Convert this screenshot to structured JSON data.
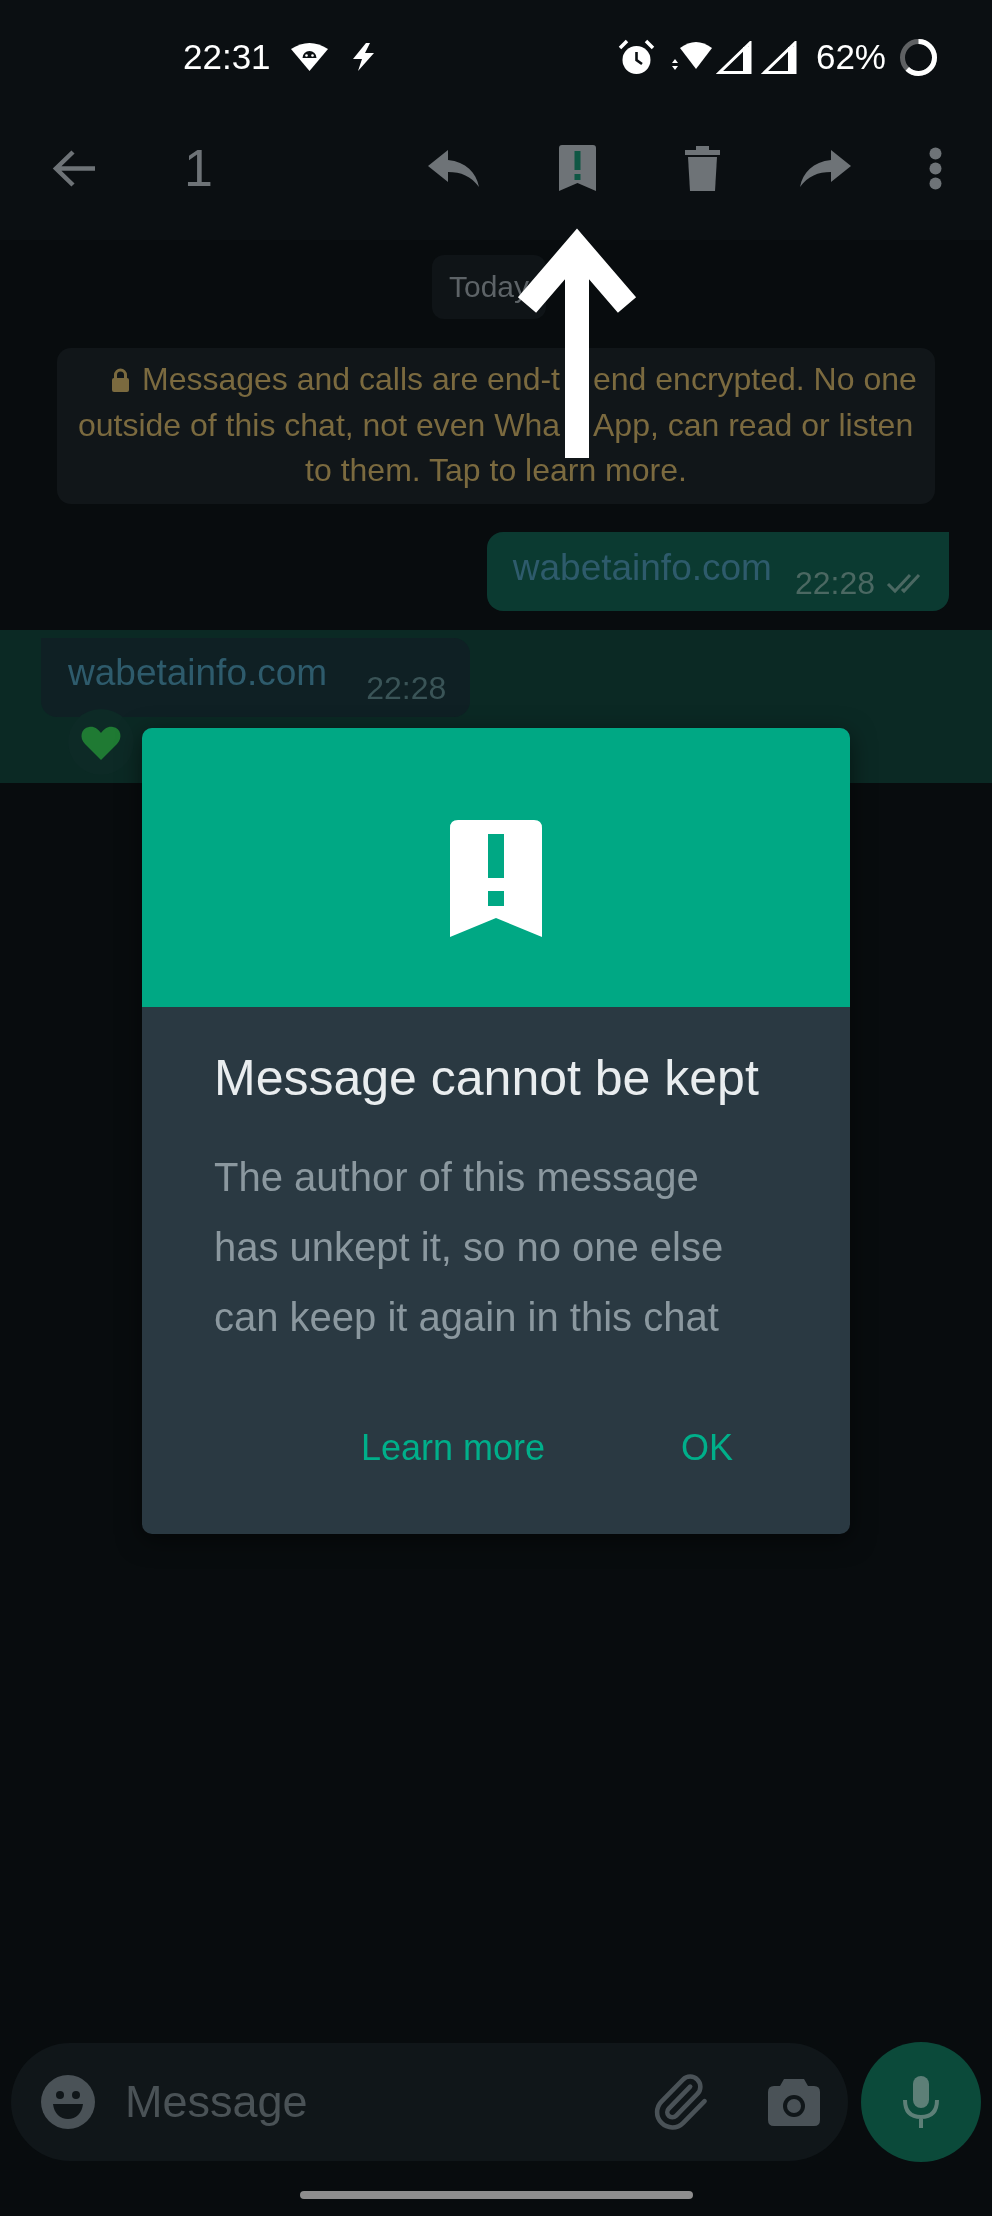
{
  "status_bar": {
    "time": "22:31",
    "battery": "62%"
  },
  "toolbar": {
    "selected_count": "1"
  },
  "chat": {
    "date": "Today",
    "encryption_notice": {
      "lines": [
        [
          "Messages and calls are end-t",
          "end encrypted. No one"
        ],
        [
          "outside of this chat, not even Wha",
          "App, can read or listen"
        ],
        [
          "to them. Tap to learn more."
        ]
      ]
    },
    "messages": [
      {
        "kind": "outgoing",
        "text": "wabetainfo.com",
        "time": "22:28",
        "read": false,
        "selected": false,
        "has_reaction": false
      },
      {
        "kind": "incoming",
        "text": "wabetainfo.com",
        "time": "22:28",
        "selected": true,
        "has_reaction": true
      }
    ]
  },
  "dialog": {
    "title": "Message cannot be kept",
    "body": "The author of this message has unkept it, so no one else can keep it again in this chat",
    "buttons": [
      {
        "label": "Learn more"
      },
      {
        "label": "OK"
      }
    ]
  },
  "composer": {
    "placeholder": "Message"
  }
}
